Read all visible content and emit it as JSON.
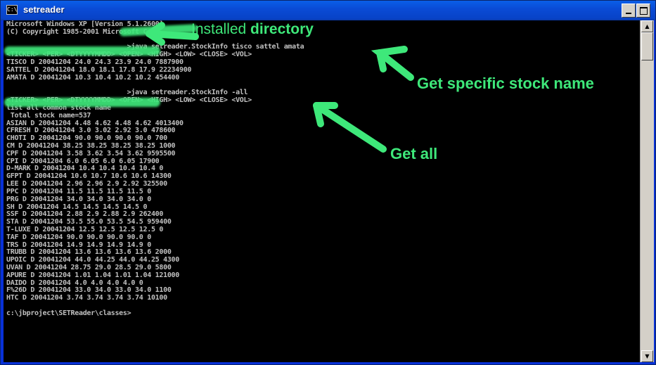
{
  "window": {
    "title": "setreader",
    "icon": "cmd-icon",
    "icon_text": "C:\\"
  },
  "console": {
    "lines": [
      "Microsoft Windows XP [Version 5.1.2600]",
      "(C) Copyright 1985-2001 Microsoft Corp.",
      "",
      "                              >java setreader.StockInfo tisco sattel amata",
      "<TICKER> <PER> <DTYYYYMMDD> <OPEN> <HIGH> <LOW> <CLOSE> <VOL>",
      "TISCO D 20041204 24.0 24.3 23.9 24.0 7887900",
      "SATTEL D 20041204 18.0 18.1 17.8 17.9 22234900",
      "AMATA D 20041204 10.3 10.4 10.2 10.2 454400",
      "",
      "                              >java setreader.StockInfo -all",
      "<TICKER> <PER> <DTYYYYMMDD> <OPEN> <HIGH> <LOW> <CLOSE> <VOL>",
      "list all common stock name",
      " Total stock name=537",
      "ASIAN D 20041204 4.48 4.62 4.48 4.62 4013400",
      "CFRESH D 20041204 3.0 3.02 2.92 3.0 478600",
      "CHOTI D 20041204 90.0 90.0 90.0 90.0 700",
      "CM D 20041204 38.25 38.25 38.25 38.25 1000",
      "CPF D 20041204 3.58 3.62 3.54 3.62 9595500",
      "CPI D 20041204 6.0 6.05 6.0 6.05 17900",
      "D-MARK D 20041204 10.4 10.4 10.4 10.4 0",
      "GFPT D 20041204 10.6 10.7 10.6 10.6 14300",
      "LEE D 20041204 2.96 2.96 2.9 2.92 325500",
      "PPC D 20041204 11.5 11.5 11.5 11.5 0",
      "PRG D 20041204 34.0 34.0 34.0 34.0 0",
      "SH D 20041204 14.5 14.5 14.5 14.5 0",
      "SSF D 20041204 2.88 2.9 2.88 2.9 262400",
      "STA D 20041204 53.5 55.0 53.5 54.5 959400",
      "T-LUXE D 20041204 12.5 12.5 12.5 12.5 0",
      "TAF D 20041204 90.0 90.0 90.0 90.0 0",
      "TRS D 20041204 14.9 14.9 14.9 14.9 0",
      "TRUBB D 20041204 13.6 13.6 13.6 13.6 2000",
      "UPOIC D 20041204 44.0 44.25 44.0 44.25 4300",
      "UVAN D 20041204 28.75 29.0 28.5 29.0 5800",
      "APURE D 20041204 1.01 1.04 1.01 1.04 121000",
      "DAIDO D 20041204 4.0 4.0 4.0 4.0 0",
      "F%26D D 20041204 33.0 34.0 33.0 34.0 1100",
      "HTC D 20041204 3.74 3.74 3.74 3.74 10100",
      "",
      "c:\\jbproject\\SETReader\\classes>"
    ]
  },
  "annotations": {
    "installed_prefix": "Installed",
    "installed_suffix": " directory",
    "specific": "Get specific stock name",
    "all": "Get all",
    "color": "#3ee87a"
  },
  "colors": {
    "console_bg": "#000000",
    "console_text": "#c0c0c0",
    "titlebar": "#0a4bd6"
  }
}
